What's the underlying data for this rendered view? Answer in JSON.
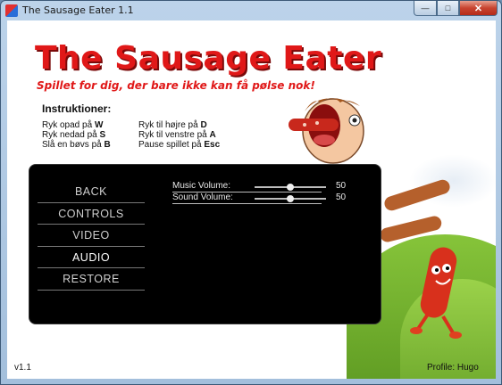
{
  "window": {
    "title": "The Sausage Eater 1.1",
    "minimize_glyph": "—",
    "maximize_glyph": "□",
    "close_glyph": "✕"
  },
  "game": {
    "logo": "The Sausage Eater",
    "subtitle": "Spillet for dig, der bare ikke kan få pølse nok!",
    "instructions": {
      "title": "Instruktioner:",
      "left": [
        {
          "text": "Ryk opad på ",
          "key": "W"
        },
        {
          "text": "Ryk nedad på ",
          "key": "S"
        },
        {
          "text": "Slå en bøvs på ",
          "key": "B"
        }
      ],
      "right": [
        {
          "text": "Ryk til højre på ",
          "key": "D"
        },
        {
          "text": "Ryk til venstre på ",
          "key": "A"
        },
        {
          "text": "Pause spillet på ",
          "key": "Esc"
        }
      ]
    },
    "menu": {
      "items": [
        "BACK",
        "CONTROLS",
        "VIDEO",
        "AUDIO",
        "RESTORE"
      ],
      "active": "AUDIO"
    },
    "audio": {
      "music_label": "Music Volume:",
      "music_value": "50",
      "music_level": 0.5,
      "sound_label": "Sound Volume:",
      "sound_value": "50",
      "sound_level": 0.5
    },
    "version": "v1.1",
    "profile": "Profile: Hugo"
  },
  "colors": {
    "logo_red": "#e01818",
    "panel_bg": "#000000",
    "grass_green": "#6fae2a",
    "sausage_red": "#d8301c"
  }
}
